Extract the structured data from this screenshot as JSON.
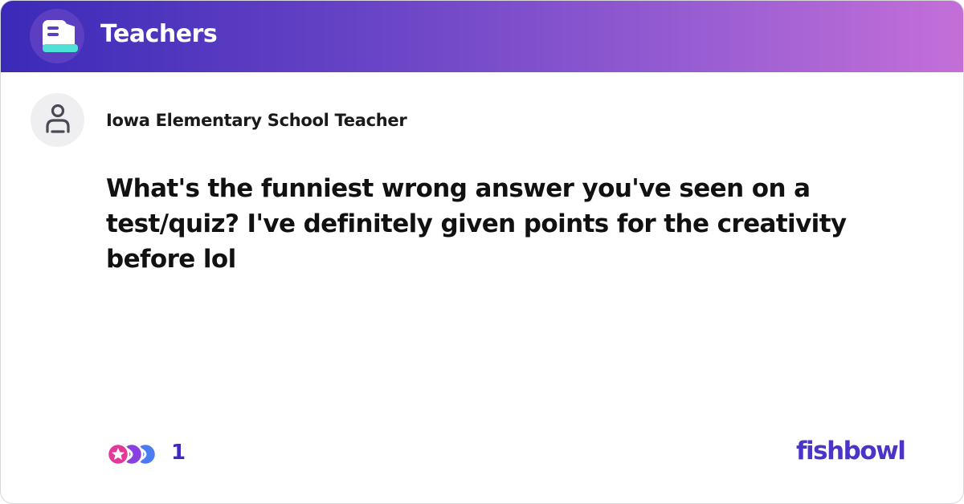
{
  "header": {
    "bowl_icon": "fishbowl-bowl-logo",
    "bowl_name": "Teachers"
  },
  "post": {
    "author_icon": "user-avatar-icon",
    "author": "Iowa Elementary School Teacher",
    "text": "What's the funniest wrong answer you've seen on a test/quiz? I've definitely given points for the creativity before lol"
  },
  "footer": {
    "reaction_icons": [
      "reaction-icon-pink",
      "reaction-icon-purple",
      "reaction-icon-blue"
    ],
    "reaction_count": "1",
    "brand": "fishbowl"
  },
  "colors": {
    "header_gradient_start": "#3b2ab8",
    "header_gradient_end": "#c46fd8",
    "brand": "#4a35c8",
    "count": "#3d2bc2"
  }
}
